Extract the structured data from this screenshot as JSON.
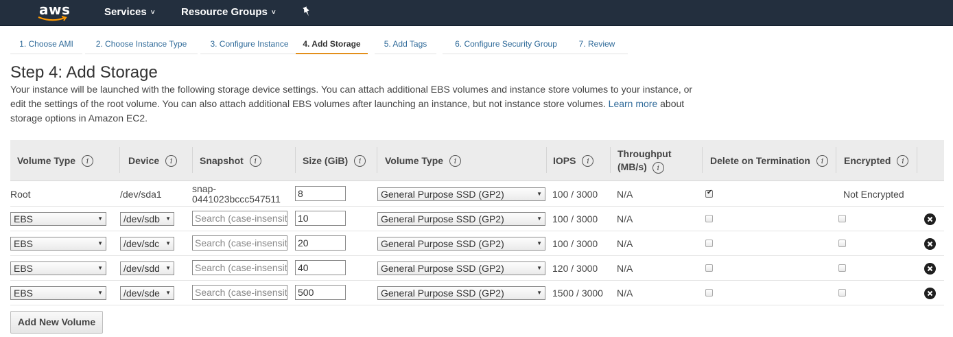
{
  "nav": {
    "logo_text": "aws",
    "services_label": "Services",
    "resource_groups_label": "Resource Groups"
  },
  "steps": [
    {
      "label": "1. Choose AMI"
    },
    {
      "label": "2. Choose Instance Type"
    },
    {
      "label": "3. Configure Instance"
    },
    {
      "label": "4. Add Storage",
      "active": true
    },
    {
      "label": "5. Add Tags"
    },
    {
      "label": "6. Configure Security Group"
    },
    {
      "label": "7. Review"
    }
  ],
  "page": {
    "title": "Step 4: Add Storage",
    "desc_before_link": "Your instance will be launched with the following storage device settings. You can attach additional EBS volumes and instance store volumes to your instance, or edit the settings of the root volume. You can also attach additional EBS volumes after launching an instance, but not instance store volumes.",
    "learn_more": "Learn more",
    "desc_after_link": "about storage options in Amazon EC2."
  },
  "table": {
    "headers": {
      "volume_type": "Volume Type",
      "device": "Device",
      "snapshot": "Snapshot",
      "size": "Size (GiB)",
      "volume_type2": "Volume Type",
      "iops": "IOPS",
      "throughput_line1": "Throughput",
      "throughput_line2": "(MB/s)",
      "delete_on_termination": "Delete on Termination",
      "encrypted": "Encrypted"
    },
    "info_glyph": "i",
    "snapshot_placeholder": "Search (case-insensit",
    "rows": [
      {
        "type": "Root",
        "device": "/dev/sda1",
        "snapshot_line1": "snap-",
        "snapshot_line2": "0441023bccc547511",
        "size": "8",
        "vol_type": "General Purpose SSD (GP2)",
        "iops": "100 / 3000",
        "throughput": "N/A",
        "delete": true,
        "encrypted": "Not Encrypted"
      },
      {
        "type": "EBS",
        "device": "/dev/sdb",
        "size": "10",
        "vol_type": "General Purpose SSD (GP2)",
        "iops": "100 / 3000",
        "throughput": "N/A",
        "delete": false,
        "encrypted_checked": false
      },
      {
        "type": "EBS",
        "device": "/dev/sdc",
        "size": "20",
        "vol_type": "General Purpose SSD (GP2)",
        "iops": "100 / 3000",
        "throughput": "N/A",
        "delete": false,
        "encrypted_checked": false
      },
      {
        "type": "EBS",
        "device": "/dev/sdd",
        "size": "40",
        "vol_type": "General Purpose SSD (GP2)",
        "iops": "120 / 3000",
        "throughput": "N/A",
        "delete": false,
        "encrypted_checked": false
      },
      {
        "type": "EBS",
        "device": "/dev/sde",
        "size": "500",
        "vol_type": "General Purpose SSD (GP2)",
        "iops": "1500 / 3000",
        "throughput": "N/A",
        "delete": false,
        "encrypted_checked": false
      }
    ]
  },
  "add_volume_label": "Add New Volume",
  "colors": {
    "nav_bg": "#232f3e",
    "link": "#2f6a99",
    "active_tab": "#e38f1a",
    "header_bg": "#ececec"
  }
}
